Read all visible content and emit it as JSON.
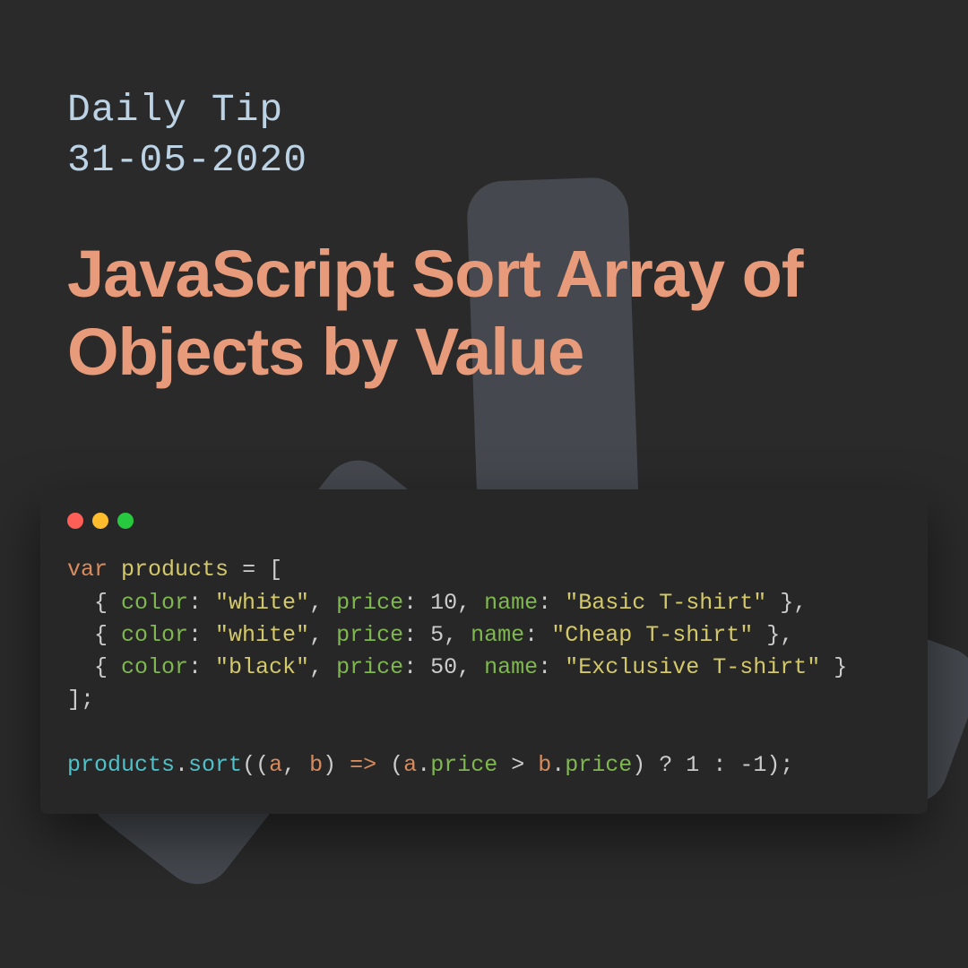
{
  "header": {
    "line1": "Daily Tip",
    "line2": "31-05-2020"
  },
  "title": "JavaScript Sort Array of Objects by Value",
  "window": {
    "dot_colors": [
      "#ff5f56",
      "#ffbd2e",
      "#27c93f"
    ]
  },
  "code": {
    "l1_kw": "var",
    "l1_var": "products",
    "l1_rest": " = [",
    "row1": {
      "color_key": "color",
      "color_val": "\"white\"",
      "price_key": "price",
      "price_val": "10",
      "name_key": "name",
      "name_val": "\"Basic T-shirt\""
    },
    "row2": {
      "color_key": "color",
      "color_val": "\"white\"",
      "price_key": "price",
      "price_val": "5",
      "name_key": "name",
      "name_val": "\"Cheap T-shirt\""
    },
    "row3": {
      "color_key": "color",
      "color_val": "\"black\"",
      "price_key": "price",
      "price_val": "50",
      "name_key": "name",
      "name_val": "\"Exclusive T-shirt\""
    },
    "close": "];",
    "sort_obj": "products",
    "sort_fn": "sort",
    "sort_a": "a",
    "sort_b": "b",
    "sort_arrow": "=>",
    "sort_prop": "price",
    "sort_one": "1",
    "sort_neg": "-1"
  }
}
